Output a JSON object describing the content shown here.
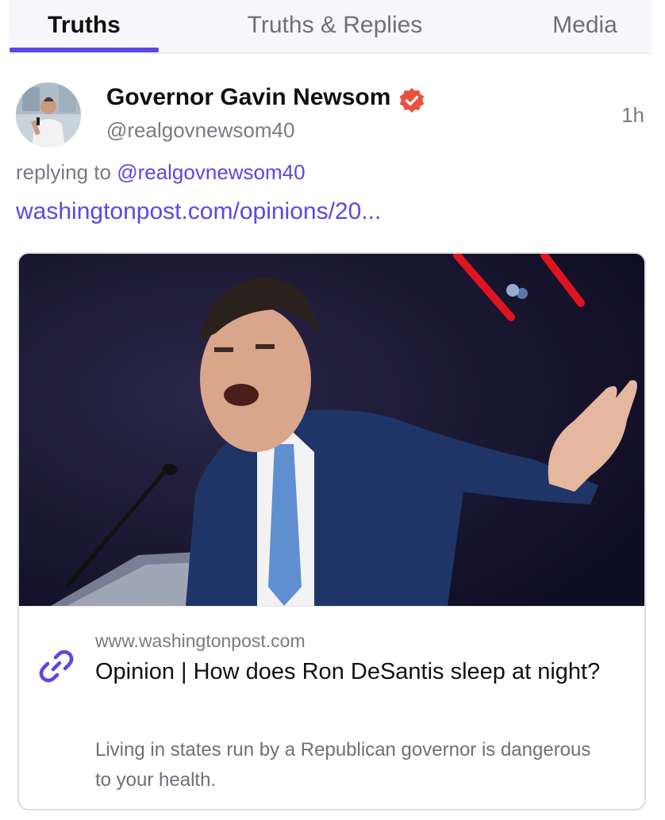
{
  "tabs": [
    {
      "label": "Truths",
      "active": true
    },
    {
      "label": "Truths & Replies",
      "active": false
    },
    {
      "label": "Media",
      "active": false
    }
  ],
  "post": {
    "author_name": "Governor Gavin Newsom",
    "handle": "@realgovnewsom40",
    "time": "1h",
    "replying_prefix": "replying to ",
    "replying_mention": "@realgovnewsom40",
    "link_text": "washingtonpost.com/opinions/20...",
    "verified_icon": "verified-badge-icon",
    "verified_color": "#e8523f"
  },
  "card": {
    "domain": "www.washingtonpost.com",
    "title": "Opinion | How does Ron DeSantis sleep at night?",
    "description": "Living in states run by a Republican governor is dangerous to your health.",
    "icon": "link-icon"
  },
  "colors": {
    "accent": "#5a48e6",
    "muted": "#7a7a84"
  }
}
